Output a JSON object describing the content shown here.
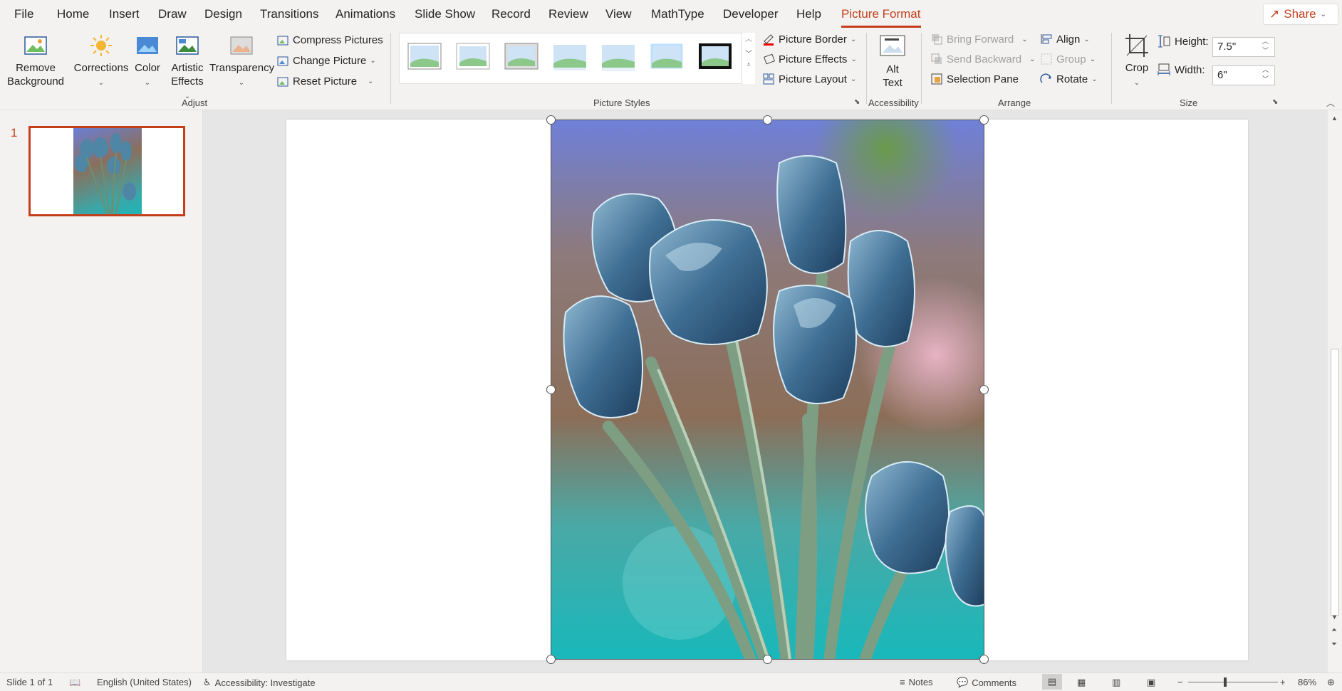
{
  "tabs": [
    "File",
    "Home",
    "Insert",
    "Draw",
    "Design",
    "Transitions",
    "Animations",
    "Slide Show",
    "Record",
    "Review",
    "View",
    "MathType",
    "Developer",
    "Help",
    "Picture Format"
  ],
  "share_label": "Share",
  "adjust": {
    "remove_background": "Remove Background",
    "corrections": "Corrections",
    "color": "Color",
    "artistic_effects": "Artistic Effects",
    "transparency": "Transparency",
    "compress": "Compress Pictures",
    "change": "Change Picture",
    "reset": "Reset Picture",
    "label": "Adjust"
  },
  "picture_styles": {
    "label": "Picture Styles",
    "border": "Picture Border",
    "effects": "Picture Effects",
    "layout": "Picture Layout"
  },
  "accessibility": {
    "alt_text": "Alt Text",
    "label": "Accessibility"
  },
  "arrange": {
    "bring_forward": "Bring Forward",
    "send_backward": "Send Backward",
    "selection_pane": "Selection Pane",
    "align": "Align",
    "group": "Group",
    "rotate": "Rotate",
    "label": "Arrange"
  },
  "size": {
    "crop": "Crop",
    "height_label": "Height:",
    "height_value": "7.5\"",
    "width_label": "Width:",
    "width_value": "6\"",
    "label": "Size"
  },
  "slide_number": "1",
  "status": {
    "slide": "Slide 1 of 1",
    "language": "English (United States)",
    "accessibility": "Accessibility: Investigate",
    "notes": "Notes",
    "comments": "Comments",
    "zoom": "86%"
  },
  "colors": {
    "accent": "#c43e1c"
  }
}
